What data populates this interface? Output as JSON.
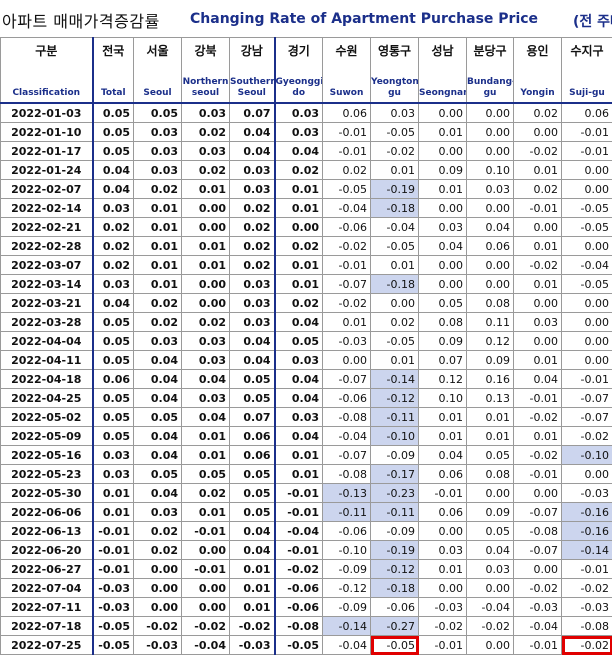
{
  "title": {
    "korean": "아파트 매매가격증감률",
    "english": "Changing Rate of Apartment Purchase Price",
    "unit": "(전 주대"
  },
  "columns": [
    {
      "ko": "구분",
      "en": "Classification"
    },
    {
      "ko": "전국",
      "en": "Total"
    },
    {
      "ko": "서울",
      "en": "Seoul"
    },
    {
      "ko": "강북",
      "en": "Northern seoul"
    },
    {
      "ko": "강남",
      "en": "Southern Seoul"
    },
    {
      "ko": "경기",
      "en": "Gyeonggi-do"
    },
    {
      "ko": "수원",
      "en": "Suwon"
    },
    {
      "ko": "영통구",
      "en": "Yeongtong-gu"
    },
    {
      "ko": "성남",
      "en": "Seongnam"
    },
    {
      "ko": "분당구",
      "en": "Bundang-gu"
    },
    {
      "ko": "용인",
      "en": "Yongin"
    },
    {
      "ko": "수지구",
      "en": "Suji-gu"
    }
  ],
  "rows": [
    {
      "date": "2022-01-03",
      "v": [
        "0.05",
        "0.05",
        "0.03",
        "0.07",
        "0.03",
        "0.06",
        "0.03",
        "0.00",
        "0.00",
        "0.02",
        "0.06"
      ]
    },
    {
      "date": "2022-01-10",
      "v": [
        "0.05",
        "0.03",
        "0.02",
        "0.04",
        "0.03",
        "-0.01",
        "-0.05",
        "0.01",
        "0.00",
        "0.00",
        "-0.01"
      ]
    },
    {
      "date": "2022-01-17",
      "v": [
        "0.05",
        "0.03",
        "0.03",
        "0.04",
        "0.04",
        "-0.01",
        "-0.02",
        "0.00",
        "0.00",
        "-0.02",
        "-0.01"
      ]
    },
    {
      "date": "2022-01-24",
      "v": [
        "0.04",
        "0.03",
        "0.02",
        "0.03",
        "0.02",
        "0.02",
        "0.01",
        "0.09",
        "0.10",
        "0.01",
        "0.00"
      ]
    },
    {
      "date": "2022-02-07",
      "v": [
        "0.04",
        "0.02",
        "0.01",
        "0.03",
        "0.01",
        "-0.05",
        "-0.19",
        "0.01",
        "0.03",
        "0.02",
        "0.00"
      ]
    },
    {
      "date": "2022-02-14",
      "v": [
        "0.03",
        "0.01",
        "0.00",
        "0.02",
        "0.01",
        "-0.04",
        "-0.18",
        "0.00",
        "0.00",
        "-0.01",
        "-0.05"
      ]
    },
    {
      "date": "2022-02-21",
      "v": [
        "0.02",
        "0.01",
        "0.00",
        "0.02",
        "0.00",
        "-0.06",
        "-0.04",
        "0.03",
        "0.04",
        "0.00",
        "-0.05"
      ]
    },
    {
      "date": "2022-02-28",
      "v": [
        "0.02",
        "0.01",
        "0.01",
        "0.02",
        "0.02",
        "-0.02",
        "-0.05",
        "0.04",
        "0.06",
        "0.01",
        "0.00"
      ]
    },
    {
      "date": "2022-03-07",
      "v": [
        "0.02",
        "0.01",
        "0.01",
        "0.02",
        "0.01",
        "-0.01",
        "0.01",
        "0.00",
        "0.00",
        "-0.02",
        "-0.04"
      ]
    },
    {
      "date": "2022-03-14",
      "v": [
        "0.03",
        "0.01",
        "0.00",
        "0.03",
        "0.01",
        "-0.07",
        "-0.18",
        "0.00",
        "0.00",
        "0.01",
        "-0.05"
      ]
    },
    {
      "date": "2022-03-21",
      "v": [
        "0.04",
        "0.02",
        "0.00",
        "0.03",
        "0.02",
        "-0.02",
        "0.00",
        "0.05",
        "0.08",
        "0.00",
        "0.00"
      ]
    },
    {
      "date": "2022-03-28",
      "v": [
        "0.05",
        "0.02",
        "0.02",
        "0.03",
        "0.04",
        "0.01",
        "0.02",
        "0.08",
        "0.11",
        "0.03",
        "0.00"
      ]
    },
    {
      "date": "2022-04-04",
      "v": [
        "0.05",
        "0.03",
        "0.03",
        "0.04",
        "0.05",
        "-0.03",
        "-0.05",
        "0.09",
        "0.12",
        "0.00",
        "0.00"
      ]
    },
    {
      "date": "2022-04-11",
      "v": [
        "0.05",
        "0.04",
        "0.03",
        "0.04",
        "0.03",
        "0.00",
        "0.01",
        "0.07",
        "0.09",
        "0.01",
        "0.00"
      ]
    },
    {
      "date": "2022-04-18",
      "v": [
        "0.06",
        "0.04",
        "0.04",
        "0.05",
        "0.04",
        "-0.07",
        "-0.14",
        "0.12",
        "0.16",
        "0.04",
        "-0.01"
      ]
    },
    {
      "date": "2022-04-25",
      "v": [
        "0.05",
        "0.04",
        "0.03",
        "0.05",
        "0.04",
        "-0.06",
        "-0.12",
        "0.10",
        "0.13",
        "-0.01",
        "-0.07"
      ]
    },
    {
      "date": "2022-05-02",
      "v": [
        "0.05",
        "0.05",
        "0.04",
        "0.07",
        "0.03",
        "-0.08",
        "-0.11",
        "0.01",
        "0.01",
        "-0.02",
        "-0.07"
      ]
    },
    {
      "date": "2022-05-09",
      "v": [
        "0.05",
        "0.04",
        "0.01",
        "0.06",
        "0.04",
        "-0.04",
        "-0.10",
        "0.01",
        "0.01",
        "0.01",
        "-0.02"
      ]
    },
    {
      "date": "2022-05-16",
      "v": [
        "0.03",
        "0.04",
        "0.01",
        "0.06",
        "0.01",
        "-0.07",
        "-0.09",
        "0.04",
        "0.05",
        "-0.02",
        "-0.10"
      ]
    },
    {
      "date": "2022-05-23",
      "v": [
        "0.03",
        "0.05",
        "0.05",
        "0.05",
        "0.01",
        "-0.08",
        "-0.17",
        "0.06",
        "0.08",
        "-0.01",
        "0.00"
      ]
    },
    {
      "date": "2022-05-30",
      "v": [
        "0.01",
        "0.04",
        "0.02",
        "0.05",
        "-0.01",
        "-0.13",
        "-0.23",
        "-0.01",
        "0.00",
        "0.00",
        "-0.03"
      ]
    },
    {
      "date": "2022-06-06",
      "v": [
        "0.01",
        "0.03",
        "0.01",
        "0.05",
        "-0.01",
        "-0.11",
        "-0.11",
        "0.06",
        "0.09",
        "-0.07",
        "-0.16"
      ]
    },
    {
      "date": "2022-06-13",
      "v": [
        "-0.01",
        "0.02",
        "-0.01",
        "0.04",
        "-0.04",
        "-0.06",
        "-0.09",
        "0.00",
        "0.05",
        "-0.08",
        "-0.16"
      ]
    },
    {
      "date": "2022-06-20",
      "v": [
        "-0.01",
        "0.02",
        "0.00",
        "0.04",
        "-0.01",
        "-0.10",
        "-0.19",
        "0.03",
        "0.04",
        "-0.07",
        "-0.14"
      ]
    },
    {
      "date": "2022-06-27",
      "v": [
        "-0.01",
        "0.00",
        "-0.01",
        "0.01",
        "-0.02",
        "-0.09",
        "-0.12",
        "0.01",
        "0.03",
        "0.00",
        "-0.01"
      ]
    },
    {
      "date": "2022-07-04",
      "v": [
        "-0.03",
        "0.00",
        "0.00",
        "0.01",
        "-0.06",
        "-0.12",
        "-0.18",
        "0.00",
        "0.00",
        "-0.02",
        "-0.02"
      ]
    },
    {
      "date": "2022-07-11",
      "v": [
        "-0.03",
        "0.00",
        "0.00",
        "0.01",
        "-0.06",
        "-0.09",
        "-0.06",
        "-0.03",
        "-0.04",
        "-0.03",
        "-0.03"
      ]
    },
    {
      "date": "2022-07-18",
      "v": [
        "-0.05",
        "-0.02",
        "-0.02",
        "-0.02",
        "-0.08",
        "-0.14",
        "-0.27",
        "-0.02",
        "-0.02",
        "-0.04",
        "-0.08"
      ]
    },
    {
      "date": "2022-07-25",
      "v": [
        "-0.05",
        "-0.03",
        "-0.04",
        "-0.03",
        "-0.05",
        "-0.04",
        "-0.05",
        "-0.01",
        "0.00",
        "-0.01",
        "-0.02"
      ]
    }
  ],
  "highlight_color": "#ccd5ee",
  "box_color": "#e00000",
  "header_color": "#1b2f8a",
  "highlighted_cells": [
    {
      "row": 4,
      "col": 7
    },
    {
      "row": 5,
      "col": 7
    },
    {
      "row": 9,
      "col": 7
    },
    {
      "row": 14,
      "col": 7
    },
    {
      "row": 15,
      "col": 7
    },
    {
      "row": 16,
      "col": 7
    },
    {
      "row": 17,
      "col": 7
    },
    {
      "row": 18,
      "col": 11
    },
    {
      "row": 19,
      "col": 7
    },
    {
      "row": 20,
      "col": 6
    },
    {
      "row": 20,
      "col": 7
    },
    {
      "row": 21,
      "col": 6
    },
    {
      "row": 21,
      "col": 7
    },
    {
      "row": 21,
      "col": 11
    },
    {
      "row": 22,
      "col": 11
    },
    {
      "row": 23,
      "col": 7
    },
    {
      "row": 23,
      "col": 11
    },
    {
      "row": 24,
      "col": 7
    },
    {
      "row": 25,
      "col": 7
    },
    {
      "row": 27,
      "col": 6
    },
    {
      "row": 27,
      "col": 7
    }
  ],
  "boxed_cells": [
    {
      "row": 28,
      "col": 7
    },
    {
      "row": 28,
      "col": 11
    }
  ]
}
